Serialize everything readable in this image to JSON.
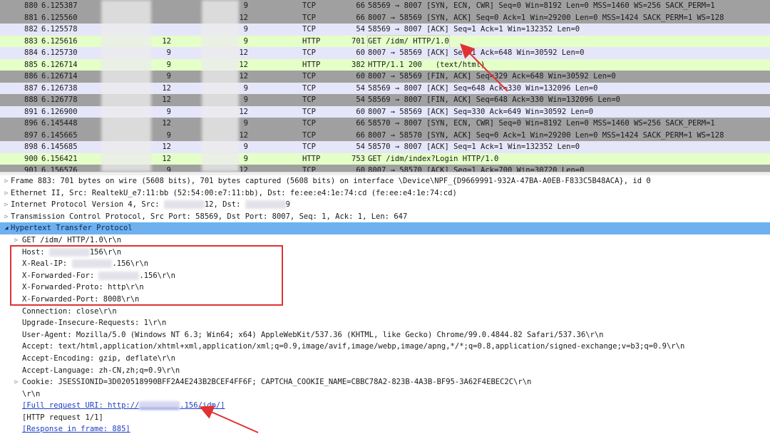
{
  "packets": [
    {
      "no": "880",
      "time": "6.125387",
      "src": "",
      "dst": "9",
      "proto": "TCP",
      "len": "66",
      "info": "58569 → 8007 [SYN, ECN, CWR] Seq=0 Win=8192 Len=0 MSS=1460 WS=256 SACK_PERM=1",
      "bg": "#a0a0a0",
      "fg": "#1a1a1a"
    },
    {
      "no": "881",
      "time": "6.125560",
      "src": "",
      "dst": "12",
      "proto": "TCP",
      "len": "66",
      "info": "8007 → 58569 [SYN, ACK] Seq=0 Ack=1 Win=29200 Len=0 MSS=1424 SACK_PERM=1 WS=128",
      "bg": "#a0a0a0",
      "fg": "#1a1a1a"
    },
    {
      "no": "882",
      "time": "6.125578",
      "src": "",
      "dst": "9",
      "proto": "TCP",
      "len": "54",
      "info": "58569 → 8007 [ACK] Seq=1 Ack=1 Win=132352 Len=0",
      "bg": "#e6e6fa",
      "fg": "#1a1a1a"
    },
    {
      "no": "883",
      "time": "6.125616",
      "src": "12",
      "dst": "9",
      "proto": "HTTP",
      "len": "701",
      "info": "GET /idm/ HTTP/1.0",
      "bg": "#e4ffc7",
      "fg": "#1a1a1a",
      "selected": true
    },
    {
      "no": "884",
      "time": "6.125730",
      "src": "9",
      "dst": "12",
      "proto": "TCP",
      "len": "60",
      "info": "8007 → 58569 [ACK] Seq=1 Ack=648 Win=30592 Len=0",
      "bg": "#e6e6fa",
      "fg": "#1a1a1a"
    },
    {
      "no": "885",
      "time": "6.126714",
      "src": "9",
      "dst": "12",
      "proto": "HTTP",
      "len": "382",
      "info": "HTTP/1.1 200   (text/html)",
      "bg": "#e4ffc7",
      "fg": "#1a1a1a"
    },
    {
      "no": "886",
      "time": "6.126714",
      "src": "9",
      "dst": "12",
      "proto": "TCP",
      "len": "60",
      "info": "8007 → 58569 [FIN, ACK] Seq=329 Ack=648 Win=30592 Len=0",
      "bg": "#a0a0a0",
      "fg": "#1a1a1a"
    },
    {
      "no": "887",
      "time": "6.126738",
      "src": "12",
      "dst": "9",
      "proto": "TCP",
      "len": "54",
      "info": "58569 → 8007 [ACK] Seq=648 Ack=330 Win=132096 Len=0",
      "bg": "#e6e6fa",
      "fg": "#1a1a1a"
    },
    {
      "no": "888",
      "time": "6.126778",
      "src": "12",
      "dst": "9",
      "proto": "TCP",
      "len": "54",
      "info": "58569 → 8007 [FIN, ACK] Seq=648 Ack=330 Win=132096 Len=0",
      "bg": "#a0a0a0",
      "fg": "#1a1a1a"
    },
    {
      "no": "891",
      "time": "6.126900",
      "src": "9",
      "dst": "12",
      "proto": "TCP",
      "len": "60",
      "info": "8007 → 58569 [ACK] Seq=330 Ack=649 Win=30592 Len=0",
      "bg": "#e6e6fa",
      "fg": "#1a1a1a"
    },
    {
      "no": "896",
      "time": "6.145448",
      "src": "12",
      "dst": "9",
      "proto": "TCP",
      "len": "66",
      "info": "58570 → 8007 [SYN, ECN, CWR] Seq=0 Win=8192 Len=0 MSS=1460 WS=256 SACK_PERM=1",
      "bg": "#a0a0a0",
      "fg": "#1a1a1a"
    },
    {
      "no": "897",
      "time": "6.145665",
      "src": "9",
      "dst": "12",
      "proto": "TCP",
      "len": "66",
      "info": "8007 → 58570 [SYN, ACK] Seq=0 Ack=1 Win=29200 Len=0 MSS=1424 SACK_PERM=1 WS=128",
      "bg": "#a0a0a0",
      "fg": "#1a1a1a"
    },
    {
      "no": "898",
      "time": "6.145685",
      "src": "12",
      "dst": "9",
      "proto": "TCP",
      "len": "54",
      "info": "58570 → 8007 [ACK] Seq=1 Ack=1 Win=132352 Len=0",
      "bg": "#e6e6fa",
      "fg": "#1a1a1a"
    },
    {
      "no": "900",
      "time": "6.156421",
      "src": "12",
      "dst": "9",
      "proto": "HTTP",
      "len": "753",
      "info": "GET /idm/index?Login HTTP/1.0",
      "bg": "#e4ffc7",
      "fg": "#1a1a1a"
    },
    {
      "no": "901",
      "time": "6.156576",
      "src": "9",
      "dst": "12",
      "proto": "TCP",
      "len": "60",
      "info": "8007 → 58570 [ACK] Seq=1 Ack=700 Win=30720 Len=0",
      "bg": "#a0a0a0",
      "fg": "#1a1a1a"
    }
  ],
  "details": [
    {
      "kind": "tree",
      "expander": "▷",
      "text": "Frame 883: 701 bytes on wire (5608 bits), 701 bytes captured (5608 bits) on interface \\Device\\NPF_{D9669991-932A-47BA-A0EB-F833C5B48ACA}, id 0"
    },
    {
      "kind": "tree",
      "expander": "▷",
      "text": "Ethernet II, Src: RealtekU_e7:11:bb (52:54:00:e7:11:bb), Dst: fe:ee:e4:1e:74:cd (fe:ee:e4:1e:74:cd)"
    },
    {
      "kind": "tree",
      "expander": "▷",
      "text_a": "Internet Protocol Version 4, Src: ",
      "text_b": "12, Dst: ",
      "text_c": "9"
    },
    {
      "kind": "tree",
      "expander": "▷",
      "text": "Transmission Control Protocol, Src Port: 58569, Dst Port: 8007, Seq: 1, Ack: 1, Len: 647"
    },
    {
      "kind": "tree-open",
      "expander": "◢",
      "text": "Hypertext Transfer Protocol"
    },
    {
      "kind": "sub",
      "expander": "▷",
      "text": "GET /idm/ HTTP/1.0\\r\\n"
    },
    {
      "kind": "field",
      "text_a": "Host: ",
      "text_b": "156\\r\\n"
    },
    {
      "kind": "field",
      "text_a": "X-Real-IP: ",
      "text_b": ".156\\r\\n"
    },
    {
      "kind": "field",
      "text_a": "X-Forwarded-For: ",
      "text_b": ".156\\r\\n"
    },
    {
      "kind": "field",
      "text": "X-Forwarded-Proto: http\\r\\n"
    },
    {
      "kind": "field",
      "text": "X-Forwarded-Port: 8008\\r\\n"
    },
    {
      "kind": "field",
      "text": "Connection: close\\r\\n"
    },
    {
      "kind": "field",
      "text": "Upgrade-Insecure-Requests: 1\\r\\n"
    },
    {
      "kind": "field",
      "text": "User-Agent: Mozilla/5.0 (Windows NT 6.3; Win64; x64) AppleWebKit/537.36 (KHTML, like Gecko) Chrome/99.0.4844.82 Safari/537.36\\r\\n"
    },
    {
      "kind": "field",
      "text": "Accept: text/html,application/xhtml+xml,application/xml;q=0.9,image/avif,image/webp,image/apng,*/*;q=0.8,application/signed-exchange;v=b3;q=0.9\\r\\n"
    },
    {
      "kind": "field",
      "text": "Accept-Encoding: gzip, deflate\\r\\n"
    },
    {
      "kind": "field",
      "text": "Accept-Language: zh-CN,zh;q=0.9\\r\\n"
    },
    {
      "kind": "sub",
      "expander": "▷",
      "text": "Cookie: JSESSIONID=3D020518990BFF2A4E243B2BCEF4FF6F; CAPTCHA_COOKIE_NAME=CBBC78A2-823B-4A3B-BF95-3A62F4EBEC2C\\r\\n"
    },
    {
      "kind": "field",
      "text": "\\r\\n"
    },
    {
      "kind": "link",
      "text_a": "[Full request URI: http://",
      "text_b": ".156/idm/]"
    },
    {
      "kind": "field",
      "text": "[HTTP request 1/1]"
    },
    {
      "kind": "link",
      "text": "[Response in frame: 885]"
    }
  ],
  "colors": {
    "selection_blue": "#6fb0ef",
    "annotation_red": "#e03232",
    "http_green": "#e4ffc7",
    "tcp_lavender": "#e6e6fa",
    "tcp_flag_gray": "#a0a0a0"
  }
}
